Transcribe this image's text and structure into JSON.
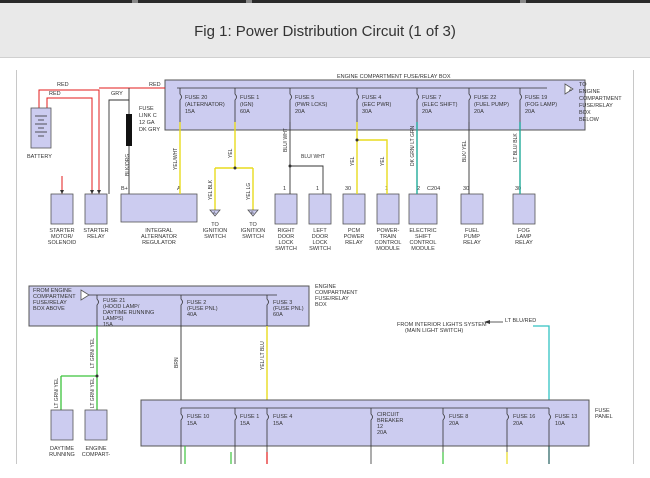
{
  "page": {
    "title": "Fig 1: Power Distribution Circuit (1 of 3)"
  },
  "top_box": {
    "label": "ENGINE COMPARTMENT FUSE/RELAY BOX",
    "note": [
      "TO",
      "ENGINE",
      "COMPARTMENT",
      "FUSE/RELAY",
      "BOX",
      "BELOW"
    ]
  },
  "fuses_top": [
    {
      "lines": [
        "FUSE 20",
        "(ALTERNATOR)",
        "15A"
      ]
    },
    {
      "lines": [
        "FUSE 1",
        "(IGN)",
        "60A"
      ]
    },
    {
      "lines": [
        "FUSE 5",
        "(PWR LCKS)",
        "20A"
      ]
    },
    {
      "lines": [
        "FUSE 4",
        "(EEC PWR)",
        "30A"
      ]
    },
    {
      "lines": [
        "FUSE 7",
        "(ELEC SHIFT)",
        "20A"
      ]
    },
    {
      "lines": [
        "FUSE 22",
        "(FUEL PUMP)",
        "20A"
      ]
    },
    {
      "lines": [
        "FUSE 19",
        "(FOG LAMP)",
        "20A"
      ]
    }
  ],
  "wires": {
    "red": "RED",
    "gry": "GRY",
    "blk_org": "BLK/ORG",
    "yel_wht": "YEL/WHT",
    "yel": "YEL",
    "blu_wht": "BLU/ WHT",
    "blu_wht_v": "BLU/ WHT",
    "yel_v": "YEL",
    "yel_v2": "YEL",
    "dk_grn_lt_grn": "DK GRN/ LT GRN",
    "blk_yel": "BLK/ YEL",
    "lt_blu_blk": "LT BLU/ BLK",
    "yel_blk": "YEL BLK",
    "yel_lg": "YEL LG",
    "brn": "BRN",
    "yel_lt_blu": "YEL/ LT BLU",
    "lt_grn_yel_a": "LT GRN/ YEL",
    "lt_grn_yel_b": "LT GRN/ YEL",
    "lt_grn_yel_c": "LT GRN/ YEL",
    "lt_blu_red": "LT BLU/RED"
  },
  "fuse_link": [
    "FUSE",
    "LINK C",
    "12 GA",
    "DK GRY"
  ],
  "battery": "BATTERY",
  "pins": {
    "bplus": "B+",
    "a": "A",
    "p1": "1",
    "p1b": "1",
    "p30a": "30",
    "p1c": "1",
    "p2": "2",
    "c204": "C204",
    "p30b": "30",
    "p30c": "30",
    "a2": "A",
    "b2": "B"
  },
  "components_top": [
    {
      "lines": [
        "STARTER",
        "MOTOR/",
        "SOLENOID"
      ]
    },
    {
      "lines": [
        "STARTER",
        "RELAY"
      ]
    },
    {
      "lines": [
        "INTEGRAL",
        "ALTERNATOR",
        "REGULATOR"
      ]
    },
    {
      "lines": [
        "TO",
        "IGNITION",
        "SWITCH"
      ]
    },
    {
      "lines": [
        "TO",
        "IGNITION",
        "SWITCH"
      ]
    },
    {
      "lines": [
        "RIGHT",
        "DOOR",
        "LOCK",
        "SWITCH"
      ]
    },
    {
      "lines": [
        "LEFT",
        "DOOR",
        "LOCK",
        "SWITCH"
      ]
    },
    {
      "lines": [
        "PCM",
        "POWER",
        "RELAY"
      ]
    },
    {
      "lines": [
        "POWER-",
        "TRAIN",
        "CONTROL",
        "MODULE"
      ]
    },
    {
      "lines": [
        "ELECTRIC",
        "SHIFT",
        "CONTROL",
        "MODULE"
      ]
    },
    {
      "lines": [
        "FUEL",
        "PUMP",
        "RELAY"
      ]
    },
    {
      "lines": [
        "FOG",
        "LAMP",
        "RELAY"
      ]
    }
  ],
  "mid_box": {
    "label": [
      "ENGINE",
      "COMPARTMENT",
      "FUSE/RELAY",
      "BOX"
    ],
    "from": [
      "FROM ENGINE",
      "COMPARTMENT",
      "FUSE/RELAY",
      "BOX ABOVE"
    ],
    "fuses": [
      {
        "lines": [
          "FUSE 21",
          "(HOOD LAMP/",
          "DAYTIME RUNNING",
          "LAMPS)",
          "15A"
        ]
      },
      {
        "lines": [
          "FUSE 2",
          "(FUSE PNL)",
          "40A"
        ]
      },
      {
        "lines": [
          "FUSE 3",
          "(FUSE PNL)",
          "60A"
        ]
      }
    ]
  },
  "interior_note": [
    "FROM INTERIOR LIGHTS SYSTEM",
    "(MAIN LIGHT SWITCH)"
  ],
  "fuse_panel": {
    "label": [
      "FUSE",
      "PANEL"
    ],
    "fuses": [
      {
        "lines": [
          "FUSE 10",
          "15A"
        ]
      },
      {
        "lines": [
          "FUSE 1",
          "15A"
        ]
      },
      {
        "lines": [
          "FUSE 4",
          "15A"
        ]
      },
      {
        "lines": [
          "CIRCUIT",
          "BREAKER",
          "12",
          "20A"
        ]
      },
      {
        "lines": [
          "FUSE 8",
          "20A"
        ]
      },
      {
        "lines": [
          "FUSE 16",
          "20A"
        ]
      },
      {
        "lines": [
          "FUSE 13",
          "10A"
        ]
      }
    ]
  },
  "components_bottom": [
    {
      "lines": [
        "DAYTIME",
        "RUNNING"
      ]
    },
    {
      "lines": [
        "ENGINE",
        "COMPART-"
      ]
    }
  ],
  "colors": {
    "box_fill": "#ccccf0",
    "box_stroke": "#555555",
    "wire": "#333333",
    "red": "#e31b1b",
    "yellow": "#e8dc1e",
    "green": "#3cc33c",
    "lt_green": "#66dd66",
    "teal": "#22aa99",
    "cyan": "#33c2c2"
  }
}
